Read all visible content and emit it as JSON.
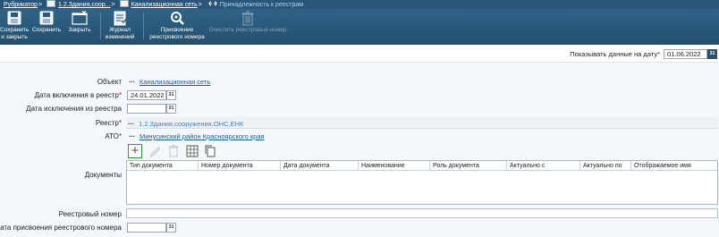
{
  "breadcrumb": {
    "items": [
      "Рубрикатор",
      "1.2.Здания,соор...",
      "Канализационная сеть",
      "Принадлежность к реестрам"
    ],
    "sep": ">"
  },
  "toolbar": {
    "buttons": [
      {
        "label1": "Сохранить",
        "label2": "и закрыть",
        "icon": "save-close-icon",
        "enabled": true
      },
      {
        "label1": "Сохранить",
        "label2": "",
        "icon": "save-icon",
        "enabled": true
      },
      {
        "label1": "Закрыть",
        "label2": "",
        "icon": "close-window-icon",
        "enabled": true
      },
      {
        "label1": "Журнал",
        "label2": "изменений",
        "icon": "journal-icon",
        "enabled": true
      },
      {
        "label1": "Присвоение",
        "label2": "реестрового номера",
        "icon": "assign-number-icon",
        "enabled": true
      },
      {
        "label1": "Очистить реестровый номер",
        "label2": "",
        "icon": "trash-icon",
        "enabled": false
      }
    ]
  },
  "date_filter": {
    "label": "Показывать данные на дату",
    "value": "01.06.2022",
    "cal": "31"
  },
  "form": {
    "object": {
      "label": "Объект",
      "value": "Канализационная сеть",
      "dots": "..."
    },
    "include_date": {
      "label": "Дата включения в реестр",
      "value": "24.01.2022",
      "cal": "31"
    },
    "exclude_date": {
      "label": "Дата исключения из реестра",
      "value": "",
      "cal": "31"
    },
    "reestr": {
      "label": "Реестр",
      "value": "1.2.Здания,сооружения,ОНС,ЕНК",
      "dots": "..."
    },
    "ato": {
      "label": "АТО",
      "value": "Минусинский район Красноярского края",
      "dots": "..."
    },
    "documents": {
      "label": "Документы"
    },
    "reg_number": {
      "label": "Реестровый номер",
      "value": ""
    },
    "reg_date": {
      "label": "Дата присвоения реестрового номера",
      "value": "",
      "cal": "31"
    }
  },
  "grid": {
    "columns": [
      "Тип документа",
      "Номер документа",
      "Дата документа",
      "Наименование",
      "Роль документа",
      "Актуально с",
      "Актуально по",
      "Отображаемое имя"
    ],
    "add_symbol": "+"
  },
  "colors": {
    "toolbar": "#2b5a7c",
    "link": "#1d5a9c",
    "required": "#d0021b",
    "add_border": "#2c9b3e"
  }
}
